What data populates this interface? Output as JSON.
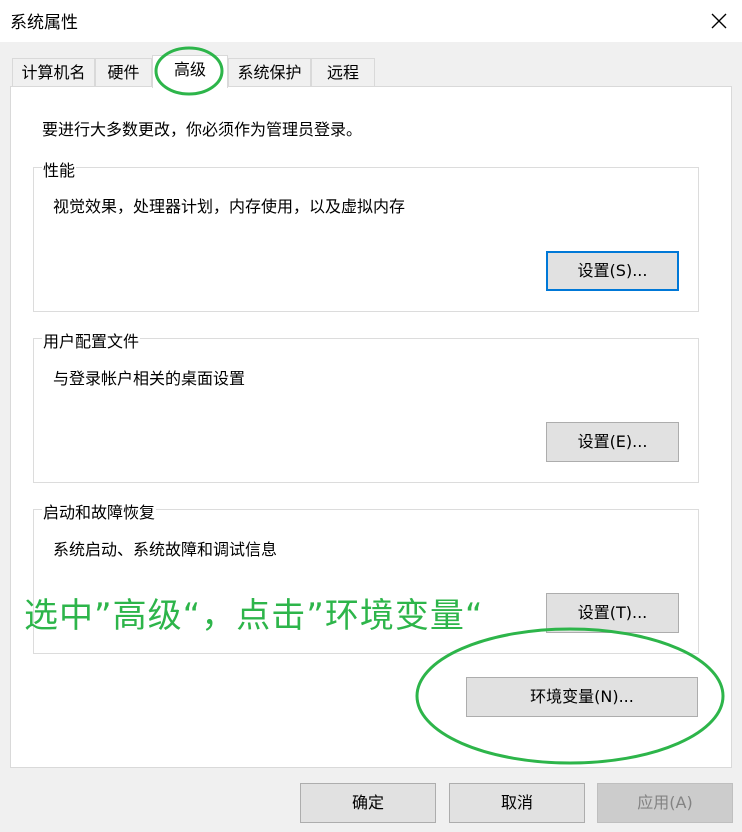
{
  "window": {
    "title": "系统属性"
  },
  "tabs": [
    {
      "label": "计算机名"
    },
    {
      "label": "硬件"
    },
    {
      "label": "高级"
    },
    {
      "label": "系统保护"
    },
    {
      "label": "远程"
    }
  ],
  "active_tab": "高级",
  "admin_note": "要进行大多数更改，你必须作为管理员登录。",
  "performance": {
    "title": "性能",
    "desc": "视觉效果，处理器计划，内存使用，以及虚拟内存",
    "button": "设置(S)..."
  },
  "user_profiles": {
    "title": "用户配置文件",
    "desc": "与登录帐户相关的桌面设置",
    "button": "设置(E)..."
  },
  "startup_recovery": {
    "title": "启动和故障恢复",
    "desc": "系统启动、系统故障和调试信息",
    "button": "设置(T)..."
  },
  "env_vars_button": "环境变量(N)...",
  "footer": {
    "ok": "确定",
    "cancel": "取消",
    "apply": "应用(A)"
  },
  "annotation": {
    "text": "选中”高级“，点击”环境变量“",
    "color": "#2db54a"
  },
  "icons": {
    "close": "close-icon"
  },
  "colors": {
    "focus_border": "#0078d7",
    "annotation_green": "#2db54a"
  }
}
